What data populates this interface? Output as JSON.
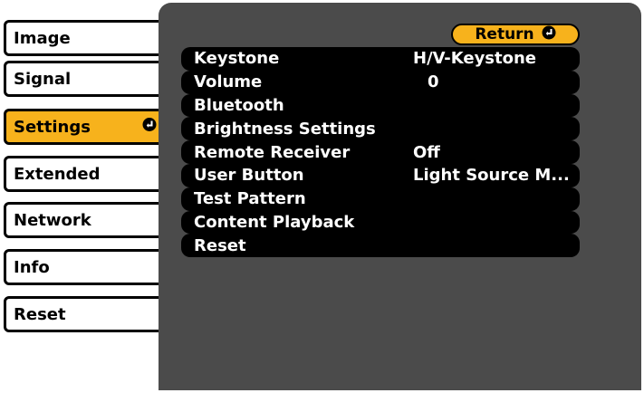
{
  "sidebar": {
    "items": [
      {
        "label": "Image"
      },
      {
        "label": "Signal"
      },
      {
        "label": "Settings"
      },
      {
        "label": "Extended"
      },
      {
        "label": "Network"
      },
      {
        "label": "Info"
      },
      {
        "label": "Reset"
      }
    ],
    "selected_index": 2
  },
  "main": {
    "return_label": "Return",
    "rows": [
      {
        "label": "Keystone",
        "value": "H/V-Keystone"
      },
      {
        "label": "Volume",
        "value": "0"
      },
      {
        "label": "Bluetooth",
        "value": ""
      },
      {
        "label": "Brightness Settings",
        "value": ""
      },
      {
        "label": "Remote Receiver",
        "value": "Off"
      },
      {
        "label": "User Button",
        "value": "Light Source M..."
      },
      {
        "label": "Test Pattern",
        "value": ""
      },
      {
        "label": "Content Playback",
        "value": ""
      },
      {
        "label": "Reset",
        "value": ""
      }
    ]
  },
  "colors": {
    "accent": "#f7b21c",
    "panel": "#4b4b4b",
    "row": "#000000"
  },
  "icons": {
    "enter": "enter-icon"
  }
}
